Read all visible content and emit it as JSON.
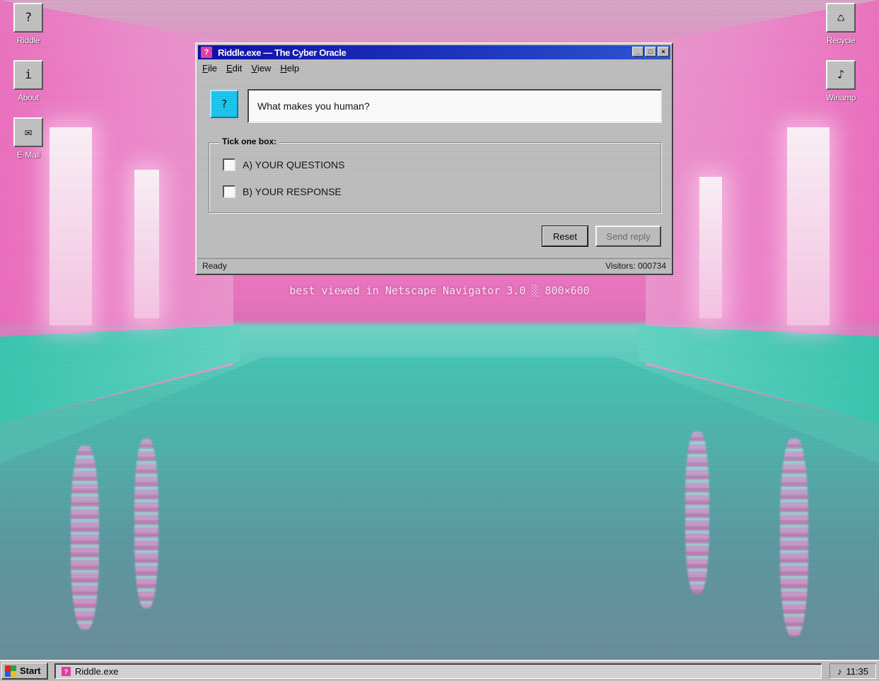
{
  "desktop": {
    "left_icons": [
      {
        "glyph": "?",
        "label": "Riddle"
      },
      {
        "glyph": "i",
        "label": "About"
      },
      {
        "glyph": "✉",
        "label": "E-Mail"
      }
    ],
    "right_icons": [
      {
        "glyph": "♺",
        "label": "Recycle"
      },
      {
        "glyph": "♪",
        "label": "Winamp"
      }
    ]
  },
  "window": {
    "icon_glyph": "?",
    "title": "Riddle.exe — The Cyber Oracle",
    "controls": {
      "minimize": "_",
      "maximize": "□",
      "close": "×"
    },
    "menu": {
      "file": {
        "key": "F",
        "rest": "ile"
      },
      "edit": {
        "key": "E",
        "rest": "dit"
      },
      "view": {
        "key": "V",
        "rest": "iew"
      },
      "help": {
        "key": "H",
        "rest": "elp"
      }
    },
    "question_icon_glyph": "?",
    "question": "What makes you human?",
    "group_label": "Tick one box:",
    "options": [
      {
        "label": "A) YOUR QUESTIONS",
        "checked": false
      },
      {
        "label": "B) YOUR RESPONSE",
        "checked": false
      }
    ],
    "reset_label": "Reset",
    "send_label": "Send reply",
    "status_left": "Ready",
    "status_right": "Visitors: 000734"
  },
  "banner": "best viewed in Netscape Navigator 3.0 ░ 800×600",
  "taskbar": {
    "start_label": "Start",
    "logo_colors": [
      "#e8231c",
      "#23a83a",
      "#1c5fe8",
      "#f2c21c"
    ],
    "task_icon_glyph": "?",
    "task_label": "Riddle.exe",
    "tray_glyph": "♪",
    "clock": "11:35"
  },
  "colors": {
    "titlebar": "#0c0ca8",
    "app_icon": "#e83aa6",
    "question_icon": "#19c7f0"
  }
}
